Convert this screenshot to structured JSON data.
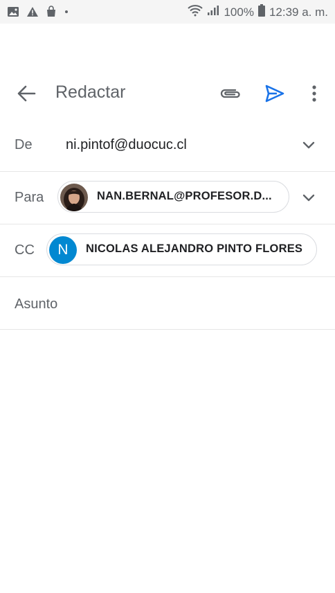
{
  "status_bar": {
    "battery": "100%",
    "time": "12:39 a. m.",
    "icons": [
      "image-icon",
      "warning-icon",
      "shopping-bag-icon",
      "dot-icon",
      "wifi-icon",
      "signal-icon",
      "battery-icon"
    ]
  },
  "app_bar": {
    "title": "Redactar",
    "icons": [
      "back-arrow-icon",
      "attachment-icon",
      "send-icon",
      "more-vert-icon"
    ],
    "accent_color": "#1a73e8"
  },
  "compose": {
    "from": {
      "label": "De",
      "value": "ni.pintof@duocuc.cl"
    },
    "to": {
      "label": "Para",
      "chip_text": "NAN.BERNAL@PROFESOR.D..."
    },
    "cc": {
      "label": "CC",
      "chip_initial": "N",
      "chip_text": "NICOLAS ALEJANDRO PINTO FLORES",
      "avatar_color": "#0288d1"
    },
    "subject": {
      "placeholder": "Asunto"
    }
  }
}
